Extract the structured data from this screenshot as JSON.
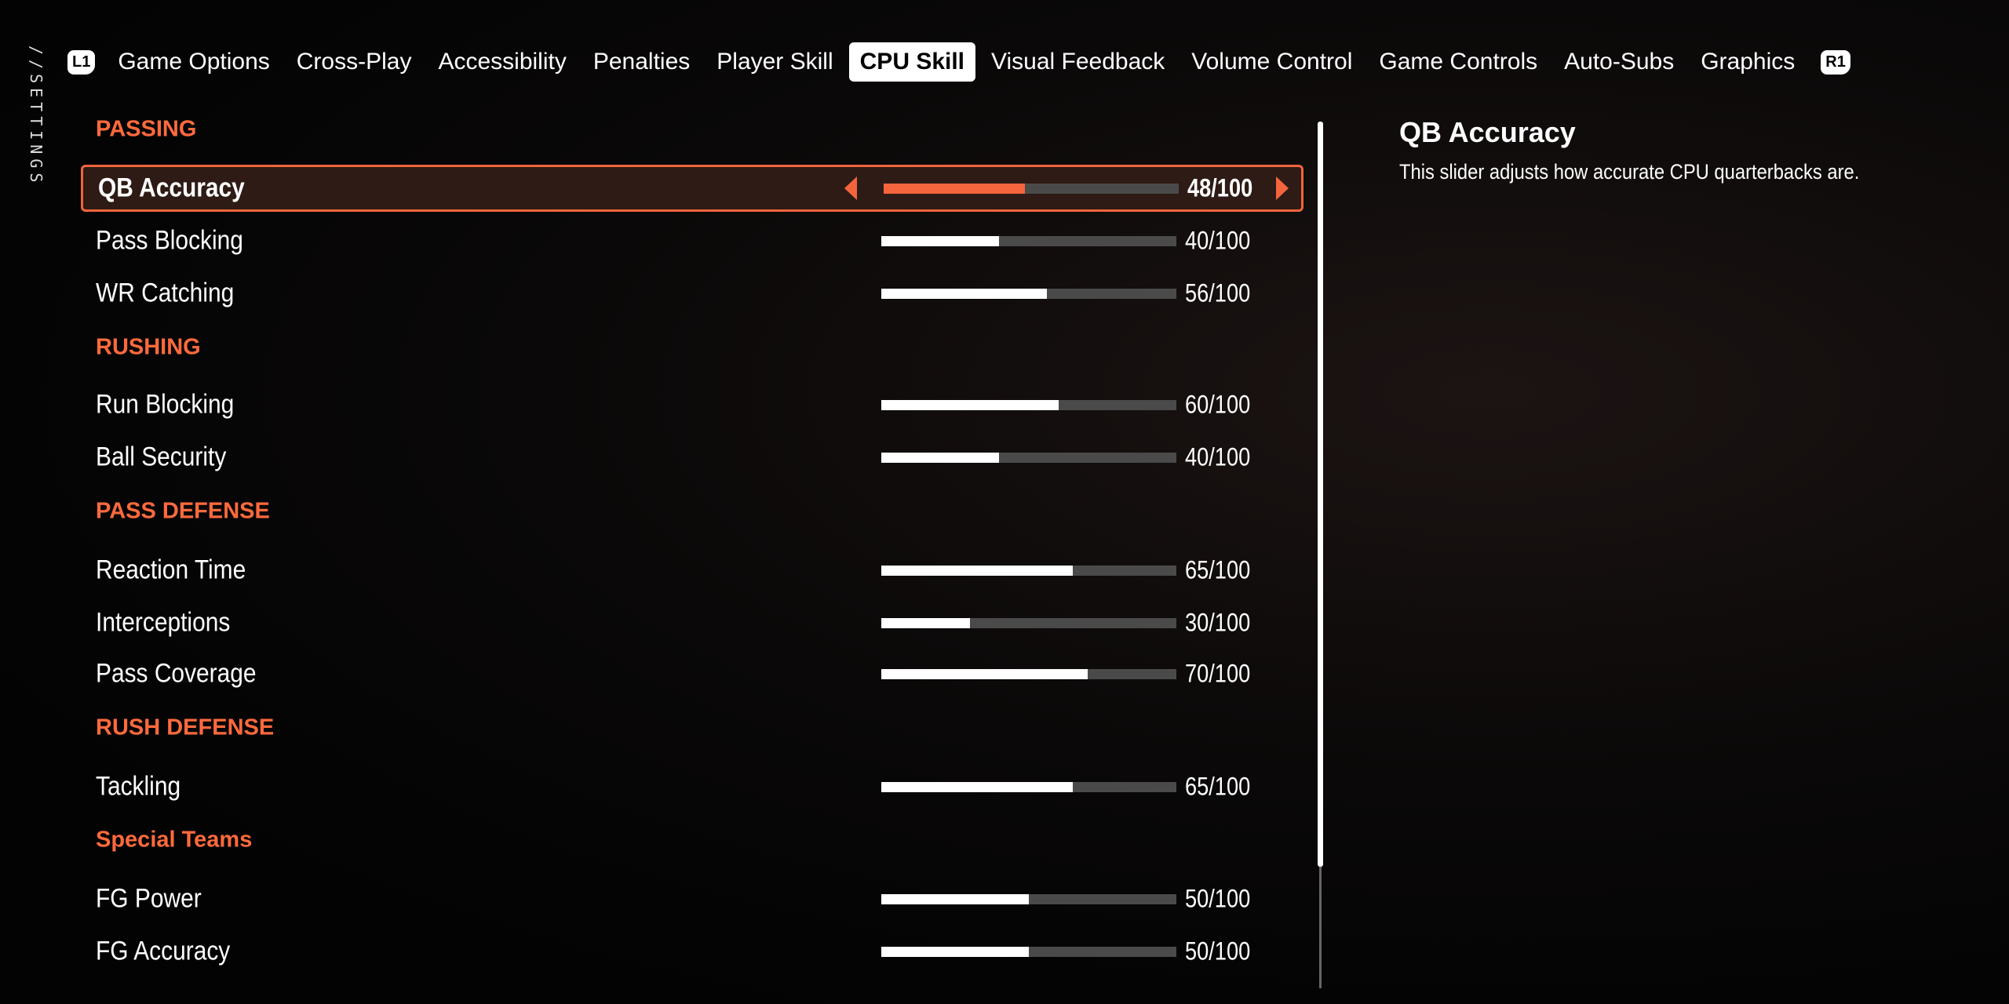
{
  "breadcrumb": "//SETTINGS",
  "tabs": {
    "left_button": "L1",
    "right_button": "R1",
    "items": [
      "Game Options",
      "Cross-Play",
      "Accessibility",
      "Penalties",
      "Player Skill",
      "CPU Skill",
      "Visual Feedback",
      "Volume Control",
      "Game Controls",
      "Auto-Subs",
      "Graphics"
    ],
    "active": "CPU Skill"
  },
  "accent_color": "#f5653d",
  "sections": [
    {
      "title": "PASSING",
      "items": [
        {
          "label": "QB Accuracy",
          "value": 48,
          "display": "48/100",
          "selected": true
        },
        {
          "label": "Pass Blocking",
          "value": 40,
          "display": "40/100"
        },
        {
          "label": "WR Catching",
          "value": 56,
          "display": "56/100"
        }
      ]
    },
    {
      "title": "RUSHING",
      "items": [
        {
          "label": "Run Blocking",
          "value": 60,
          "display": "60/100"
        },
        {
          "label": "Ball Security",
          "value": 40,
          "display": "40/100"
        }
      ]
    },
    {
      "title": "PASS DEFENSE",
      "items": [
        {
          "label": "Reaction Time",
          "value": 65,
          "display": "65/100"
        },
        {
          "label": "Interceptions",
          "value": 30,
          "display": "30/100"
        },
        {
          "label": "Pass Coverage",
          "value": 70,
          "display": "70/100"
        }
      ]
    },
    {
      "title": "RUSH DEFENSE",
      "items": [
        {
          "label": "Tackling",
          "value": 65,
          "display": "65/100"
        }
      ]
    },
    {
      "title": "Special Teams",
      "items": [
        {
          "label": "FG Power",
          "value": 50,
          "display": "50/100"
        },
        {
          "label": "FG Accuracy",
          "value": 50,
          "display": "50/100"
        }
      ]
    }
  ],
  "detail": {
    "title": "QB Accuracy",
    "description": "This slider adjusts how accurate CPU quarterbacks are."
  }
}
